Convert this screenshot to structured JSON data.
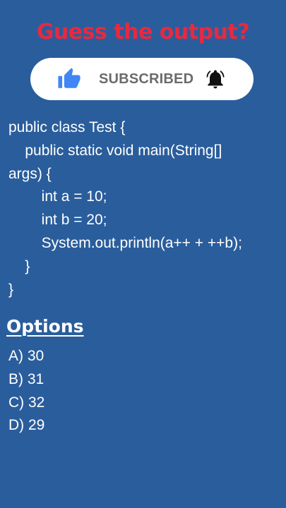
{
  "title": "Guess the output?",
  "subscribe_pill": {
    "label": "SUBSCRIBED",
    "thumb_icon": "thumbs-up-icon",
    "bell_icon": "bell-icon",
    "thumb_color": "#4285f4"
  },
  "code_lines": [
    "public class Test {",
    "    public static void main(String[]",
    "args) {",
    "        int a = 10;",
    "        int b = 20;",
    "        System.out.println(a++ + ++b);",
    "    }",
    "}"
  ],
  "options_heading": "Options",
  "options": [
    "A) 30",
    "B) 31",
    "C) 32",
    "D) 29"
  ],
  "colors": {
    "background": "#2a5d9c",
    "title": "#e8293f",
    "text": "#ffffff"
  }
}
